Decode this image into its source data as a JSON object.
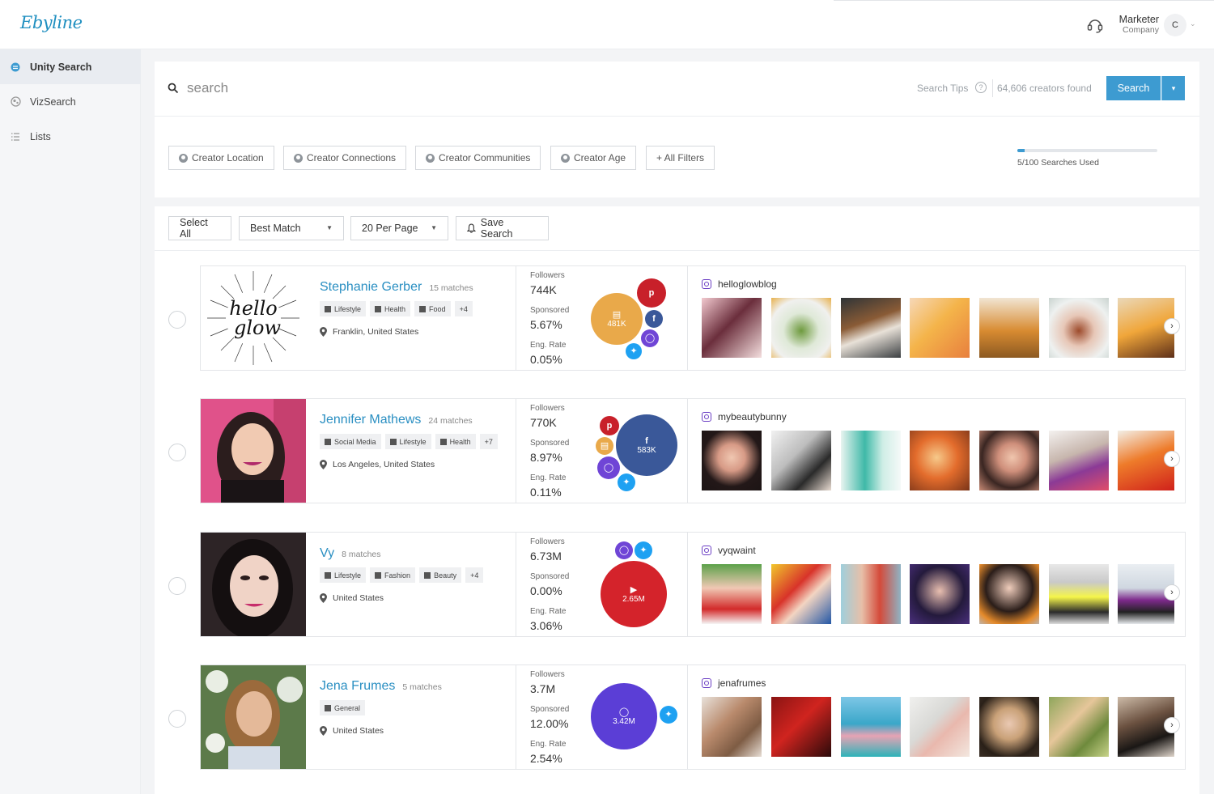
{
  "app": {
    "logo_text": "Ebyline",
    "user_name": "Marketer",
    "user_company": "Company",
    "avatar_initial": "C"
  },
  "sidebar": {
    "items": [
      {
        "label": "Unity Search",
        "icon": "unity-icon",
        "active": true
      },
      {
        "label": "VizSearch",
        "icon": "viz-icon",
        "active": false
      },
      {
        "label": "Lists",
        "icon": "list-icon",
        "active": false
      }
    ]
  },
  "search": {
    "placeholder": "search",
    "tips_label": "Search Tips",
    "creators_found": "64,606 creators found",
    "button_label": "Search"
  },
  "filters": {
    "buttons": [
      "Creator Location",
      "Creator Connections",
      "Creator Communities",
      "Creator Age",
      "+ All Filters"
    ],
    "usage_text": "5/100 Searches Used",
    "usage_fraction": 0.05
  },
  "toolbar": {
    "select_all": "Select All",
    "sort": "Best Match",
    "per_page": "20 Per Page",
    "save_search": "Save Search"
  },
  "stat_labels": {
    "followers": "Followers",
    "sponsored": "Sponsored",
    "eng_rate": "Eng. Rate"
  },
  "creators": [
    {
      "name": "Stephanie Gerber",
      "matches": "15 matches",
      "tags": [
        "Lifestyle",
        "Health",
        "Food",
        "+4"
      ],
      "location": "Franklin, United States",
      "followers": "744K",
      "sponsored": "5.67%",
      "eng_rate": "0.05%",
      "main_bubble_label": "481K",
      "handle": "helloglowblog"
    },
    {
      "name": "Jennifer Mathews",
      "matches": "24 matches",
      "tags": [
        "Social Media",
        "Lifestyle",
        "Health",
        "+7"
      ],
      "location": "Los Angeles, United States",
      "followers": "770K",
      "sponsored": "8.97%",
      "eng_rate": "0.11%",
      "main_bubble_label": "583K",
      "handle": "mybeautybunny"
    },
    {
      "name": "Vy",
      "matches": "8 matches",
      "tags": [
        "Lifestyle",
        "Fashion",
        "Beauty",
        "+4"
      ],
      "location": "United States",
      "followers": "6.73M",
      "sponsored": "0.00%",
      "eng_rate": "3.06%",
      "main_bubble_label": "2.65M",
      "handle": "vyqwaint"
    },
    {
      "name": "Jena Frumes",
      "matches": "5 matches",
      "tags": [
        "General"
      ],
      "location": "United States",
      "followers": "3.7M",
      "sponsored": "12.00%",
      "eng_rate": "2.54%",
      "main_bubble_label": "3.42M",
      "handle": "jenafrumes"
    }
  ],
  "colors": {
    "accent": "#3d9bd1",
    "link": "#2a8fc2",
    "pinterest": "#c8202a",
    "facebook": "#3a5899",
    "instagram": "#6f45d6",
    "twitter": "#1ea1f2",
    "blog": "#e9a94a",
    "youtube": "#d4232b"
  }
}
